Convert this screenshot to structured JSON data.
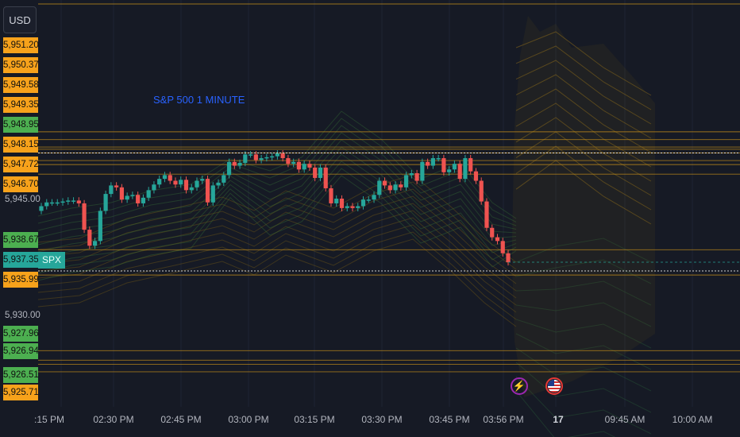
{
  "toolbar": {
    "currency": "USD"
  },
  "chart_title": "S&P 500 1 MINUTE",
  "symbol_tag": "SPX",
  "price_axis": {
    "orange_tags": [
      "5,951.20",
      "5,950.37",
      "5,949.58",
      "5,949.35",
      "5,948.15",
      "5,947.72",
      "5,946.70",
      "5,935.99",
      "5,925.71"
    ],
    "green_tags": [
      "5,948.95",
      "5,938.67",
      "5,927.96",
      "5,926.94",
      "5,926.51"
    ],
    "current_price": "5,937.35",
    "plain_labels": [
      "5,945.00",
      "5,930.00"
    ]
  },
  "time_axis": [
    ":15 PM",
    "02:30 PM",
    "02:45 PM",
    "03:00 PM",
    "03:15 PM",
    "03:30 PM",
    "03:45 PM",
    "03:56 PM",
    "17",
    "09:45 AM",
    "10:00 AM"
  ],
  "events": [
    {
      "icon": "lightning-icon"
    },
    {
      "icon": "us-flag-icon"
    }
  ],
  "colors": {
    "background": "#161a25",
    "up_candle": "#26a69a",
    "down_candle": "#ef5350",
    "level_line": "#c8901a",
    "orange_tag": "#f7a21b",
    "green_tag": "#4caf50",
    "title": "#2962ff"
  },
  "chart_data": {
    "type": "candlestick",
    "title": "S&P 500 1 MINUTE",
    "symbol": "SPX",
    "currency": "USD",
    "ylim": [
      5925,
      5953
    ],
    "levels": [
      5951.2,
      5950.37,
      5949.58,
      5949.35,
      5948.95,
      5948.15,
      5947.72,
      5946.7,
      5938.67,
      5935.99,
      5927.96,
      5926.94,
      5926.51,
      5925.71
    ],
    "close_series": [
      5943.3,
      5943.7,
      5943.7,
      5943.7,
      5943.8,
      5943.9,
      5943.9,
      5943.6,
      5940.8,
      5939.1,
      5939.6,
      5942.8,
      5944.6,
      5945.5,
      5945.3,
      5944.0,
      5944.4,
      5944.5,
      5943.6,
      5944.2,
      5945.0,
      5945.6,
      5946.2,
      5946.6,
      5946.0,
      5945.6,
      5946.1,
      5945.0,
      5945.3,
      5946.0,
      5946.2,
      5943.7,
      5945.5,
      5945.8,
      5946.6,
      5948.0,
      5947.6,
      5947.9,
      5948.8,
      5948.8,
      5948.2,
      5948.4,
      5948.5,
      5948.6,
      5948.9,
      5948.4,
      5947.8,
      5948.0,
      5947.2,
      5947.8,
      5947.4,
      5946.3,
      5947.4,
      5945.2,
      5943.6,
      5944.1,
      5943.1,
      5943.3,
      5943.1,
      5943.3,
      5944.0,
      5944.0,
      5944.5,
      5946.0,
      5945.5,
      5945.0,
      5945.6,
      5945.3,
      5946.6,
      5946.8,
      5946.0,
      5948.0,
      5947.6,
      5948.4,
      5948.4,
      5946.9,
      5947.2,
      5947.8,
      5946.2,
      5948.4,
      5947.0,
      5946.0,
      5943.8,
      5941.0,
      5940.0,
      5939.6,
      5938.3,
      5937.35
    ]
  }
}
